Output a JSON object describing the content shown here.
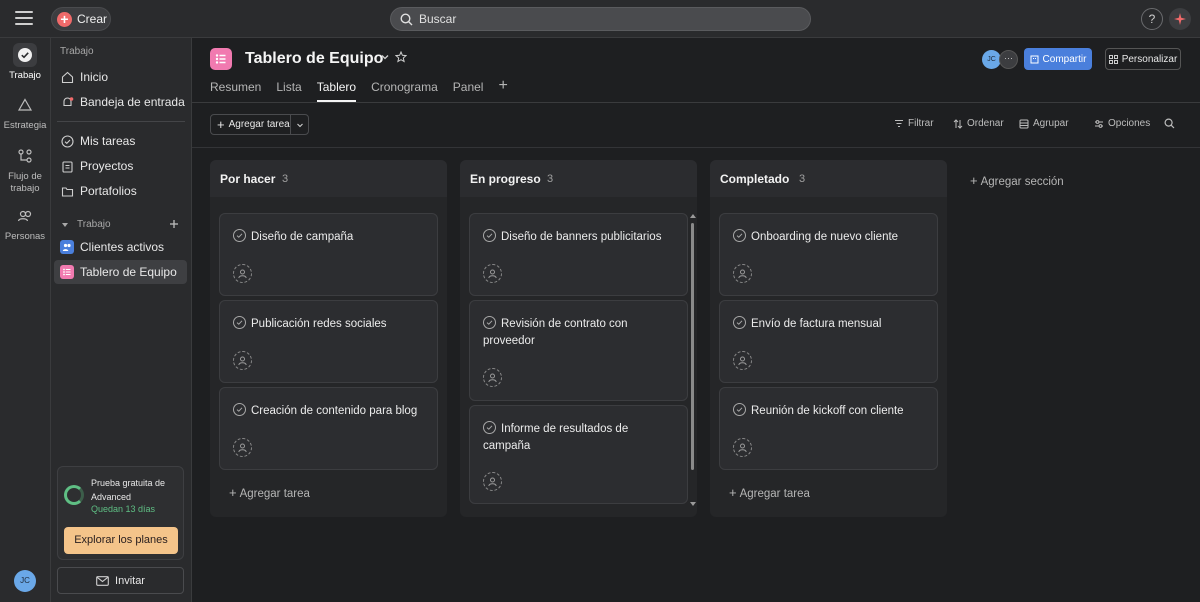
{
  "topbar": {
    "create_label": "Crear",
    "search_placeholder": "Buscar",
    "help_label": "?"
  },
  "rail": {
    "items": [
      {
        "label": "Trabajo",
        "icon": "check-circle-icon"
      },
      {
        "label": "Estrategia",
        "icon": "triangle-icon"
      },
      {
        "label": "Flujo de trabajo",
        "icon": "workflow-icon"
      },
      {
        "label": "Personas",
        "icon": "people-icon"
      }
    ],
    "avatar_initials": "JC"
  },
  "sidebar": {
    "heading": "Trabajo",
    "items": [
      {
        "label": "Inicio",
        "icon": "home-icon"
      },
      {
        "label": "Bandeja de entrada",
        "icon": "bell-icon"
      },
      {
        "label": "Mis tareas",
        "icon": "check-circle-icon"
      },
      {
        "label": "Proyectos",
        "icon": "clipboard-icon"
      },
      {
        "label": "Portafolios",
        "icon": "folder-icon"
      }
    ],
    "section_label": "Trabajo",
    "projects": [
      {
        "label": "Clientes activos",
        "icon": "team-icon",
        "color": "#4a7fdc"
      },
      {
        "label": "Tablero de Equipo",
        "icon": "list-icon",
        "color": "#f17ab0"
      }
    ],
    "trial": {
      "title": "Prueba gratuita de Advanced",
      "days_left": "Quedan 13 días",
      "button": "Explorar los planes"
    },
    "invite_label": "Invitar"
  },
  "project": {
    "title": "Tablero de Equipo",
    "avatar_initials": "JC",
    "share_label": "Compartir",
    "customize_label": "Personalizar",
    "tabs": [
      {
        "label": "Resumen",
        "active": false
      },
      {
        "label": "Lista",
        "active": false
      },
      {
        "label": "Tablero",
        "active": true
      },
      {
        "label": "Cronograma",
        "active": false
      },
      {
        "label": "Panel",
        "active": false
      }
    ]
  },
  "toolbar": {
    "add_task": "Agregar tarea",
    "filter": "Filtrar",
    "sort": "Ordenar",
    "group": "Agrupar",
    "options": "Opciones"
  },
  "board": {
    "add_task_label": "Agregar tarea",
    "add_section_label": "Agregar sección",
    "columns": [
      {
        "title": "Por hacer",
        "count": "3",
        "cards": [
          {
            "title": "Diseño de campaña"
          },
          {
            "title": "Publicación redes sociales"
          },
          {
            "title": "Creación de contenido para blog"
          }
        ]
      },
      {
        "title": "En progreso",
        "count": "3",
        "cards": [
          {
            "title": "Diseño de banners publicitarios"
          },
          {
            "title": "Revisión de contrato con proveedor"
          },
          {
            "title": "Informe de resultados de campaña"
          }
        ]
      },
      {
        "title": "Completado",
        "count": "3",
        "cards": [
          {
            "title": "Onboarding de nuevo cliente"
          },
          {
            "title": "Envío de factura mensual"
          },
          {
            "title": "Reunión de kickoff con cliente"
          }
        ]
      }
    ]
  }
}
